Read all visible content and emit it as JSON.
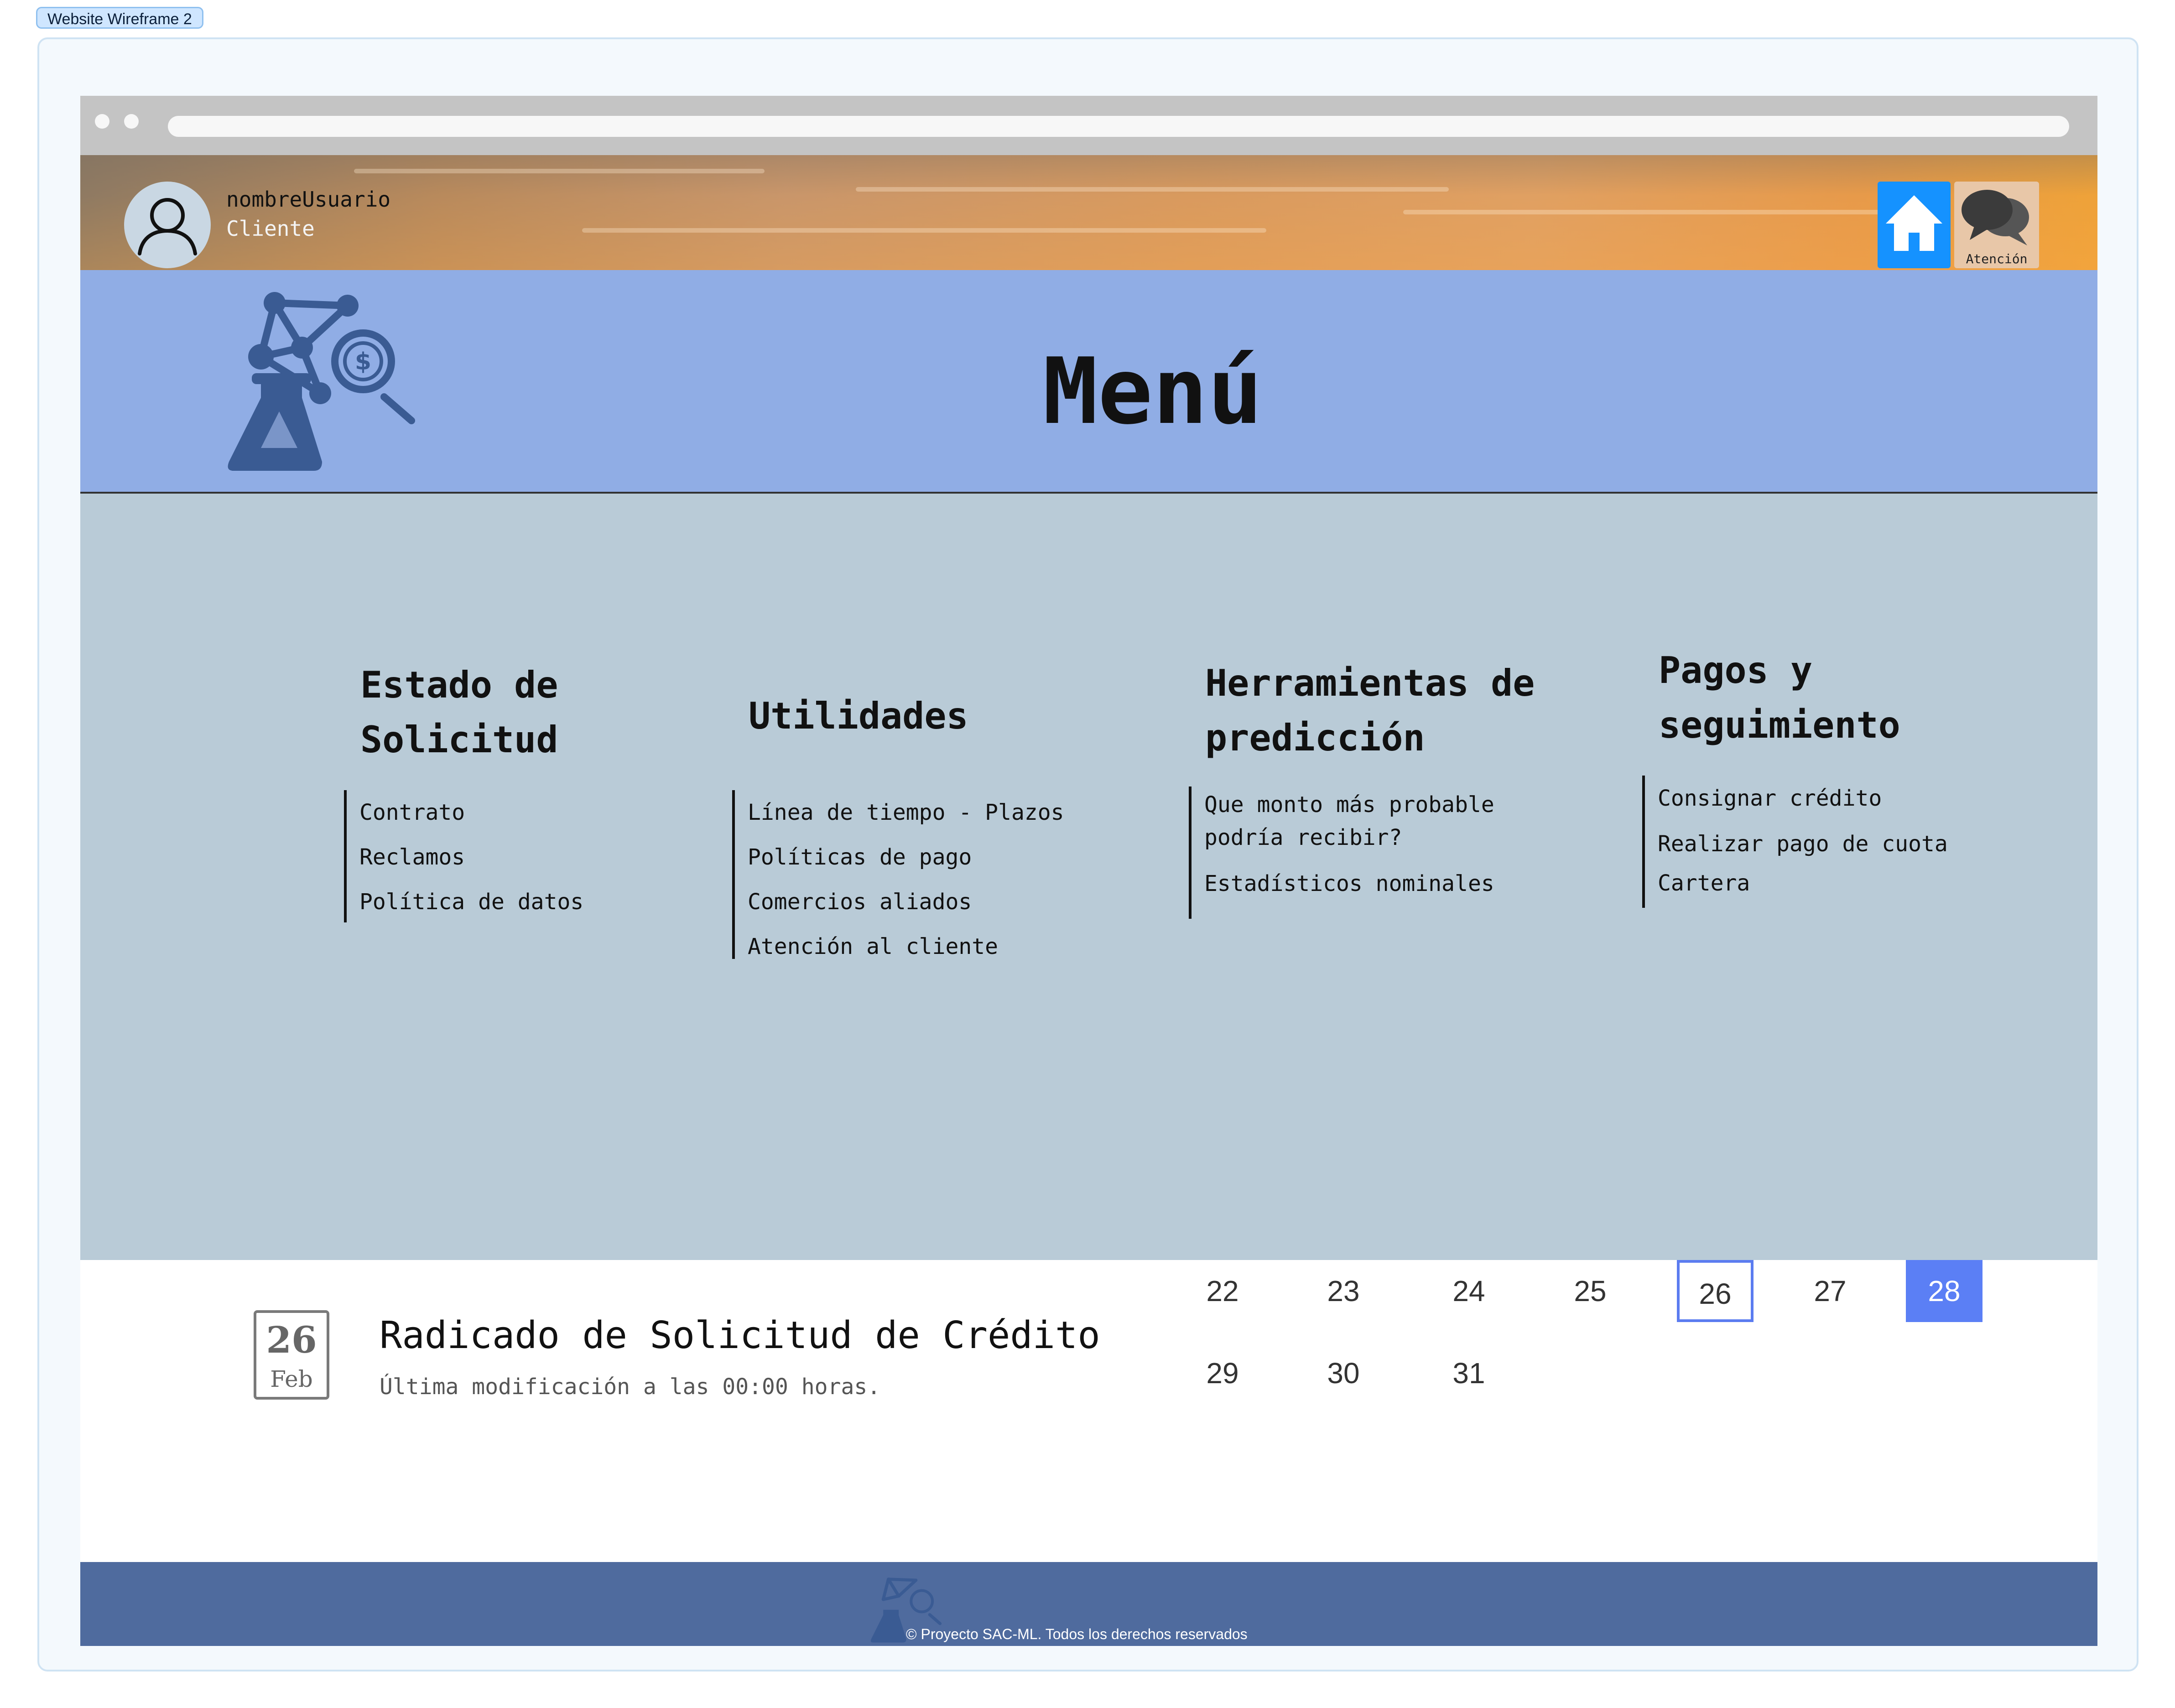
{
  "canvas": {
    "frame_label": "Website Wireframe 2"
  },
  "header": {
    "user_name": "nombreUsuario",
    "user_role": "Cliente",
    "chat_label": "Atención",
    "icons": [
      "user-icon",
      "home-icon",
      "chat-icon"
    ]
  },
  "banner": {
    "title": "Menú"
  },
  "menu": {
    "columns": [
      {
        "title": "Estado de\nSolicitud",
        "items": [
          "Contrato",
          "Reclamos",
          "Política de datos"
        ]
      },
      {
        "title": "Utilidades",
        "items": [
          "Línea de tiempo - Plazos",
          "Políticas de pago",
          "Comercios aliados",
          "Atención al cliente"
        ]
      },
      {
        "title": "Herramientas de\npredicción",
        "items": [
          "Que monto más probable\npodría recibir?",
          "Estadísticos nominales"
        ]
      },
      {
        "title": "Pagos y\nseguimiento",
        "items": [
          "Consignar crédito",
          "Realizar pago de cuota",
          "Cartera"
        ]
      }
    ]
  },
  "event": {
    "day": "26",
    "month": "Feb",
    "title": "Radicado de Solicitud de Crédito",
    "subtitle": "Última modificación a las 00:00 horas."
  },
  "calendar": {
    "days": [
      "22",
      "23",
      "24",
      "25",
      "26",
      "27",
      "28",
      "29",
      "30",
      "31"
    ],
    "today": "26",
    "selected": "28",
    "colors": {
      "outline": "#5b7cf0",
      "selected_bg": "#5b7ff5"
    }
  },
  "footer": {
    "text": "© Proyecto SAC-ML. Todos los derechos reservados"
  },
  "colors": {
    "banner_bg": "#90ade5",
    "content_bg": "#b9cbd7",
    "footer_bg": "#4f6b9e",
    "home_button": "#1592ff"
  }
}
